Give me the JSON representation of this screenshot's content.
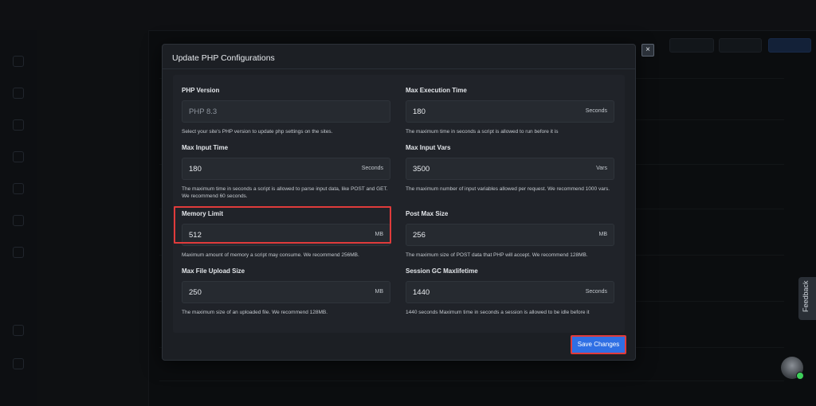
{
  "modal": {
    "title": "Update PHP Configurations",
    "close_symbol": "×",
    "save_label": "Save Changes",
    "fields": {
      "php_version": {
        "label": "PHP Version",
        "value": "PHP 8.3",
        "help": "Select your site's PHP version to update php settings on the sites."
      },
      "max_execution_time": {
        "label": "Max Execution Time",
        "value": "180",
        "unit": "Seconds",
        "help": "The maximum time in seconds a script is allowed to run before it is"
      },
      "max_input_time": {
        "label": "Max Input Time",
        "value": "180",
        "unit": "Seconds",
        "help": "The maximum time in seconds a script is allowed to parse input data, like POST and GET. We recommend 60 seconds."
      },
      "max_input_vars": {
        "label": "Max Input Vars",
        "value": "3500",
        "unit": "Vars",
        "help": "The maximum number of input variables allowed per request. We recommend 1000 vars."
      },
      "memory_limit": {
        "label": "Memory Limit",
        "value": "512",
        "unit": "MB",
        "help": "Maximum amount of memory a script may consume. We recommend 256MB."
      },
      "post_max_size": {
        "label": "Post Max Size",
        "value": "256",
        "unit": "MB",
        "help": "The maximum size of POST data that PHP will accept. We recommend 128MB."
      },
      "max_file_upload_size": {
        "label": "Max File Upload Size",
        "value": "250",
        "unit": "MB",
        "help": "The maximum size of an uploaded file. We recommend 128MB."
      },
      "session_gc_maxlifetime": {
        "label": "Session GC Maxlifetime",
        "value": "1440",
        "unit": "Seconds",
        "help": "1440 seconds Maximum time in seconds a session is allowed to be idle before it"
      }
    }
  },
  "feedback_label": "Feedback",
  "colors": {
    "accent": "#2f6fe4",
    "highlight": "#e03b3b",
    "modal_bg": "#1c1f24",
    "page_bg": "#121417"
  }
}
